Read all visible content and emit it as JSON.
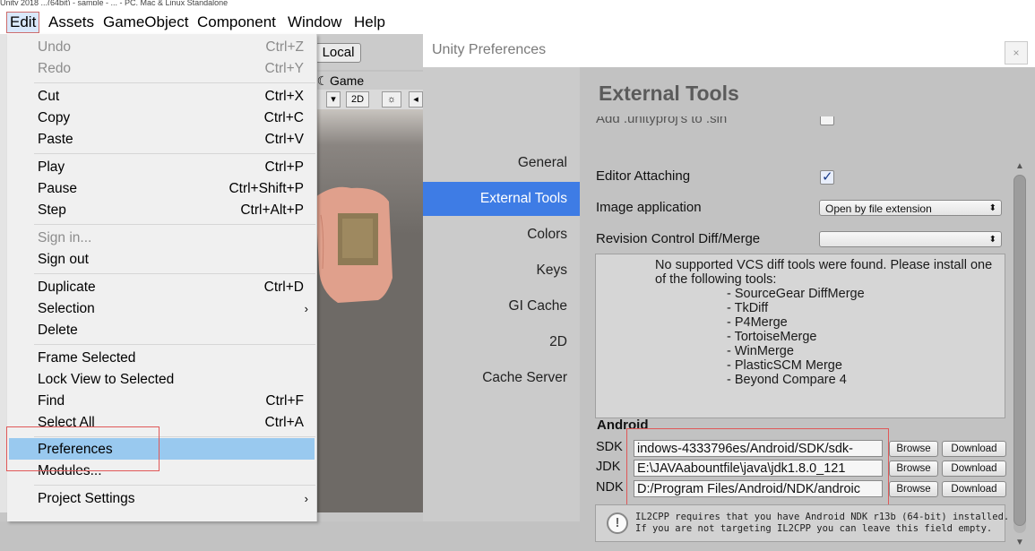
{
  "menubar": {
    "top_fragment": "Unity 2018 ...(64bit) - sample - ... - PC, Mac & Linux Standalone",
    "items": [
      "Edit",
      "Assets",
      "GameObject",
      "Component",
      "Window",
      "Help"
    ]
  },
  "scene": {
    "local_label": "Local",
    "game_tab": "Game",
    "twod_toggle": "2D"
  },
  "edit_menu": {
    "undo": {
      "label": "Undo",
      "shortcut": "Ctrl+Z"
    },
    "redo": {
      "label": "Redo",
      "shortcut": "Ctrl+Y"
    },
    "cut": {
      "label": "Cut",
      "shortcut": "Ctrl+X"
    },
    "copy": {
      "label": "Copy",
      "shortcut": "Ctrl+C"
    },
    "paste": {
      "label": "Paste",
      "shortcut": "Ctrl+V"
    },
    "play": {
      "label": "Play",
      "shortcut": "Ctrl+P"
    },
    "pause": {
      "label": "Pause",
      "shortcut": "Ctrl+Shift+P"
    },
    "step": {
      "label": "Step",
      "shortcut": "Ctrl+Alt+P"
    },
    "sign_in": {
      "label": "Sign in..."
    },
    "sign_out": {
      "label": "Sign out"
    },
    "duplicate": {
      "label": "Duplicate",
      "shortcut": "Ctrl+D"
    },
    "selection": {
      "label": "Selection",
      "arrow": "›"
    },
    "delete": {
      "label": "Delete"
    },
    "frame_selected": {
      "label": "Frame Selected"
    },
    "lock_view": {
      "label": "Lock View to Selected"
    },
    "find": {
      "label": "Find",
      "shortcut": "Ctrl+F"
    },
    "select_all": {
      "label": "Select All",
      "shortcut": "Ctrl+A"
    },
    "preferences": {
      "label": "Preferences"
    },
    "modules": {
      "label": "Modules..."
    },
    "project_settings": {
      "label": "Project Settings",
      "arrow": "›"
    }
  },
  "preferences": {
    "window_title": "Unity Preferences",
    "close_glyph": "×",
    "nav": [
      "General",
      "External Tools",
      "Colors",
      "Keys",
      "GI Cache",
      "2D",
      "Cache Server"
    ],
    "active_nav": "External Tools",
    "section_title": "External Tools",
    "add_unityproj_label": "Add .unityproj's to .sln",
    "editor_attaching_label": "Editor Attaching",
    "editor_attaching_checked": true,
    "image_application_label": "Image application",
    "image_application_value": "Open by file extension",
    "revision_control_label": "Revision Control Diff/Merge",
    "revision_control_value": "",
    "vcs_message": "No supported VCS diff tools were found. Please install one of the following tools:",
    "vcs_tools": [
      "- SourceGear DiffMerge",
      "- TkDiff",
      "- P4Merge",
      "- TortoiseMerge",
      "- WinMerge",
      "- PlasticSCM Merge",
      "- Beyond Compare 4"
    ],
    "android_header": "Android",
    "sdk": {
      "label": "SDK",
      "value": "indows-4333796es/Android/SDK/sdk-"
    },
    "jdk": {
      "label": "JDK",
      "value": "E:\\JAVAabountfile\\java\\jdk1.8.0_121"
    },
    "ndk": {
      "label": "NDK",
      "value": "D:/Program Files/Android/NDK/androic"
    },
    "browse_label": "Browse",
    "download_label": "Download",
    "il2cpp_line1": "IL2CPP requires that you have Android NDK r13b (64-bit) installed.",
    "il2cpp_line2": "If you are not targeting IL2CPP you can leave this field empty."
  },
  "colors": {
    "highlight": "#99c9ef",
    "active_nav": "#3e7ce5",
    "annotation_red": "#e05858"
  }
}
